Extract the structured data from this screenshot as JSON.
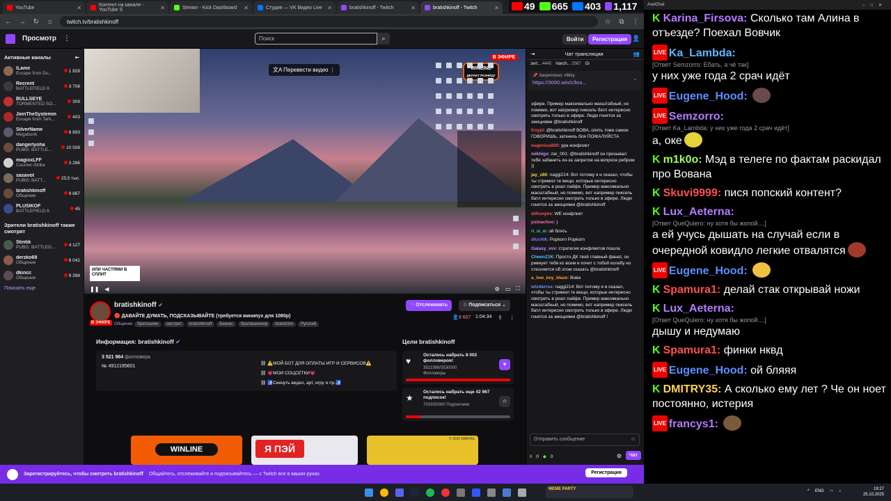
{
  "browser": {
    "tabs": [
      {
        "label": "YouTube",
        "color": "#ff0000"
      },
      {
        "label": "Контент на канале - YouTube S",
        "color": "#ff0000"
      },
      {
        "label": "Stream - Kick Dashboard",
        "color": "#53fc18"
      },
      {
        "label": "Студия — VK Видео Live",
        "color": "#0077ff"
      },
      {
        "label": "bratishkinoff - Twitch",
        "color": "#9147ff"
      },
      {
        "label": "bratishkinoff - Twitch",
        "color": "#9147ff"
      }
    ],
    "url": "twitch.tv/bratishkinoff"
  },
  "stream_stats": {
    "youtube": "49",
    "kick": "665",
    "vk": "403",
    "twitch": "1,117"
  },
  "topnav": {
    "browse": "Просмотр",
    "search_placeholder": "Поиск",
    "login": "Войти",
    "register": "Регистрация"
  },
  "sidebar": {
    "active_header": "Активные каналы",
    "channels": [
      {
        "name": "lLame",
        "game": "Escape from Du...",
        "viewers": "1 928",
        "color": "#8a6a50"
      },
      {
        "name": "Recrent",
        "game": "BATTLEFIELD 6",
        "viewers": "3 708",
        "color": "#3a3a3a"
      },
      {
        "name": "BULLSEYE",
        "game": "TORMENTED SO...",
        "viewers": "309",
        "color": "#c03030"
      },
      {
        "name": "JoinTheSystemm",
        "game": "Escape from Tark...",
        "viewers": "403",
        "color": "#aa2a2a"
      },
      {
        "name": "SilverName",
        "game": "Megabonk",
        "viewers": "6 893",
        "color": "#5a5a6a"
      },
      {
        "name": "dangerlyoha",
        "game": "PUBG: BATTLE...",
        "viewers": "10 508",
        "color": "#6a4a3a"
      },
      {
        "name": "magixxLFF",
        "game": "Counter-Strike",
        "viewers": "3 286",
        "color": "#d0d0d0"
      },
      {
        "name": "sasavot",
        "game": "PUBG: BATT...",
        "viewers": "25,5 тыс.",
        "color": "#7a6a5a"
      },
      {
        "name": "bratishkinoff",
        "game": "Общение",
        "viewers": "9 867",
        "color": "#6b4a3a"
      },
      {
        "name": "PLUSIKOF",
        "game": "BATTLEFIELD 6",
        "viewers": "45",
        "color": "#3a4a8a"
      }
    ],
    "also_header": "Зрители bratishkinoff также смотрят",
    "also": [
      {
        "name": "Stintik",
        "game": "PUBG: BATTLEG...",
        "viewers": "4 127",
        "color": "#4a5a4a"
      },
      {
        "name": "derzko69",
        "game": "Общение",
        "viewers": "6 042",
        "color": "#8a5a4a"
      },
      {
        "name": "dkincc",
        "game": "Общение",
        "viewers": "9 398",
        "color": "#5a4a5a"
      }
    ],
    "show_more": "Показать еще"
  },
  "video": {
    "translate": "Перевести видео",
    "live": "В ЭФИРЕ",
    "winline": "WINLINE",
    "winline_sub": "ДЕЛАЕТ РАЗНИЦУ",
    "irl_overlay": "ИЛИ ЧАСТЯМИ В СПЛИТ"
  },
  "stream": {
    "channel": "bratishkinoff",
    "title": "ДАВАЙТЕ ДУМАТЬ, ПОДСКАЗЫВАЙТЕ (требуется винипух для 1080р)",
    "live": "В ЭФИРЕ",
    "category": "Общение",
    "tags": [
      "братишкин",
      "смотрит",
      "bratishkinoff",
      "Бизнес",
      "братишкиноф",
      "bratishkin",
      "Русский"
    ],
    "follow": "Отслеживать",
    "subscribe": "Подписаться",
    "viewers": "9 667",
    "uptime": "1:04:34"
  },
  "about": {
    "header": "Информация: bratishkinoff",
    "followers_count": "3 521 964",
    "followers_label": "фолловера",
    "number": "№ 4912195601",
    "links": [
      "⚠️МОЙ БОТ ДЛЯ ОПЛАТЫ ИГР И СЕРВИСОВ⚠️",
      "💗МОИ СОЦСЕТКИ💗",
      "🚮Скинуть видео, арт, игру и пр.🚮"
    ]
  },
  "goals": {
    "header": "Цели bratishkinoff",
    "items": [
      {
        "title": "Осталось набрать 8 002 фолловеров!",
        "sub1": "3521998/3530000",
        "sub2": "Фолловеры",
        "progress": 0.997
      },
      {
        "title": "Осталось набрать еще 42 967 подписок!",
        "sub1": "7033/50000 Подписчики",
        "sub2": "",
        "progress": 0.14
      }
    ]
  },
  "ads": {
    "winline": "WINLINE",
    "yapay": "Я ПЭЙ",
    "marvel": "© 2025 MARVEL"
  },
  "chat": {
    "header": "Чат трансляции",
    "leaders": [
      {
        "name": "zert...",
        "value": "4445"
      },
      {
        "name": "Vanch...",
        "value": "2567"
      },
      {
        "name": "Gi",
        "value": ""
      }
    ],
    "pinned_label": "Закреплено: v6kky",
    "pinned_link": "https://3000.win/c/bra...",
    "messages": [
      {
        "user": "",
        "color": "#efeff1",
        "text": "эфире. Пример максимально масштабный, но помимо, вот например пиксель батл интересно смотреть только в эфире. Люди гонятся за эмоциями @bratishkinoff"
      },
      {
        "user": "froypl",
        "color": "#ff4f4f",
        "text": "@bratishkinoff ВОВА, опять тоже самое ГОВОРИШЬ, заткнись бля ПОЖАЛУЙСТА"
      },
      {
        "user": "eugenius800",
        "color": "#ff4f4f",
        "text": "ура конфликт"
      },
      {
        "user": "mikhigo",
        "color": "#bf94ff",
        "text": "zar_001: @bratishkinoff он призывал тебя забанить из-за запретов на вопросе ребром ))"
      },
      {
        "user": "jay_z80",
        "color": "#ffd34f",
        "text": "naggi214: Вот потому я и сказал, чтобы ты стримил те вещи, которые интересно смотреть в реал лайфе. Пример максимально масштабный, но помимо, вот например пиксель батл интересно смотреть только в эфире. Люди гонятся за эмоциями @bratishkinoff"
      },
      {
        "user": "ddhsnjws",
        "color": "#ff4f4f",
        "text": "WE конфликт"
      },
      {
        "user": "psinachoo",
        "color": "#ff6ea8",
        "text": ")"
      },
      {
        "user": "ri_w_w",
        "color": "#2fd3a8",
        "text": "ой блять"
      },
      {
        "user": "dluchtk",
        "color": "#7a7aff",
        "text": "Popkorn Popkorn"
      },
      {
        "user": "Galaxy_vvv",
        "color": "#bf94ff",
        "text": "стратегия конфликтов пошла"
      },
      {
        "user": "CheenZ1K",
        "color": "#53c4ff",
        "text": "Просто ДК твой главный фанат, он ривнует тебя ко всем и хочет с тобой колабу но стесняется об этом сказать @bratishkinoff"
      },
      {
        "user": "a_low_key_blaze",
        "color": "#ff9f2f",
        "text": "Вова"
      },
      {
        "user": "w1nterrss",
        "color": "#7a9aff",
        "text": "naggi214: Вот потому я и сказал, чтобы ты стримил те вещи, которые интересно смотреть в реал лайфе. Пример максимально масштабный, но помимо, вот например пиксель батл интересно смотреть только в эфире. Люди гонятся за эмоциями @bratishkinoff !"
      }
    ],
    "input_placeholder": "Отправить сообщение",
    "points": "0",
    "bits": "0",
    "send": "Чат"
  },
  "banner": {
    "bold": "Зарегистрируйтесь, чтобы смотреть bratishkinoff",
    "text": "Общайтесь, отслеживайте и подписывайтесь — с Twitch все в ваших руках.",
    "register": "Регистрация"
  },
  "overlay": {
    "title": "AxelChat",
    "messages": [
      {
        "platform": "kick",
        "user": "Karina_Firsova:",
        "color": "#b57bff",
        "reply": "",
        "text": "Сколько там Алина в отъезде? Поехал Вовчик",
        "emote": ""
      },
      {
        "platform": "vk",
        "user": "Ka_Lambda:",
        "color": "#5fb8ff",
        "reply": "[Ответ Semzorro: Ебать, а чё так]",
        "text": "у них уже года 2 срач идёт",
        "emote": ""
      },
      {
        "platform": "vk",
        "user": "Eugene_Hood:",
        "color": "#5f8fff",
        "reply": "",
        "text": "",
        "emote": "#6a4a4a"
      },
      {
        "platform": "vk",
        "user": "Semzorro:",
        "color": "#b57bff",
        "reply": "[Ответ Ka_Lambda: у них уже года 2 срач идёт]",
        "text": "а, оке",
        "emote": "#e6d23a"
      },
      {
        "platform": "kick",
        "user": "m1k0o:",
        "color": "#9cff5a",
        "reply": "",
        "text": "Мэд в телеге по фактам раскидал про Вована",
        "emote": ""
      },
      {
        "platform": "kick",
        "user": "Skuvi9999:",
        "color": "#ff4f4f",
        "reply": "",
        "text": "пися попский контент?",
        "emote": ""
      },
      {
        "platform": "kick",
        "user": "Lux_Aeterna:",
        "color": "#b57bff",
        "reply": "[Ответ QueQuiero: ну хотя бы жопой....]",
        "text": "а ей учусь дышать на случай если в очередной ковидло легкие отвалятся",
        "emote": "#a03a2a"
      },
      {
        "platform": "vk",
        "user": "Eugene_Hood:",
        "color": "#5f8fff",
        "reply": "",
        "text": "",
        "emote": "#f0c040"
      },
      {
        "platform": "kick",
        "user": "Spamura1:",
        "color": "#ff4f4f",
        "reply": "",
        "text": "делай стак открывай ножи",
        "emote": ""
      },
      {
        "platform": "kick",
        "user": "Lux_Aeterna:",
        "color": "#b57bff",
        "reply": "[Ответ QueQuiero: ну хотя бы жопой....]",
        "text": "дышу и недумаю",
        "emote": ""
      },
      {
        "platform": "kick",
        "user": "Spamura1:",
        "color": "#ff4f4f",
        "reply": "",
        "text": "финки нквд",
        "emote": ""
      },
      {
        "platform": "vk",
        "user": "Eugene_Hood:",
        "color": "#5f8fff",
        "reply": "",
        "text": "ой бляяя",
        "emote": ""
      },
      {
        "platform": "kick",
        "user": "DMITRY35:",
        "color": "#ffd34f",
        "reply": "",
        "text": "А сколько ему лет ? Че он ноет постоянно, истерия",
        "emote": ""
      },
      {
        "platform": "vk",
        "user": "francys1:",
        "color": "#b57bff",
        "reply": "",
        "text": "",
        "emote": "#7a5a3a"
      }
    ]
  },
  "taskbar": {
    "meme": "MEME PARTY",
    "lang": "ENG",
    "time": "19:27",
    "date": "25.10.2025"
  }
}
